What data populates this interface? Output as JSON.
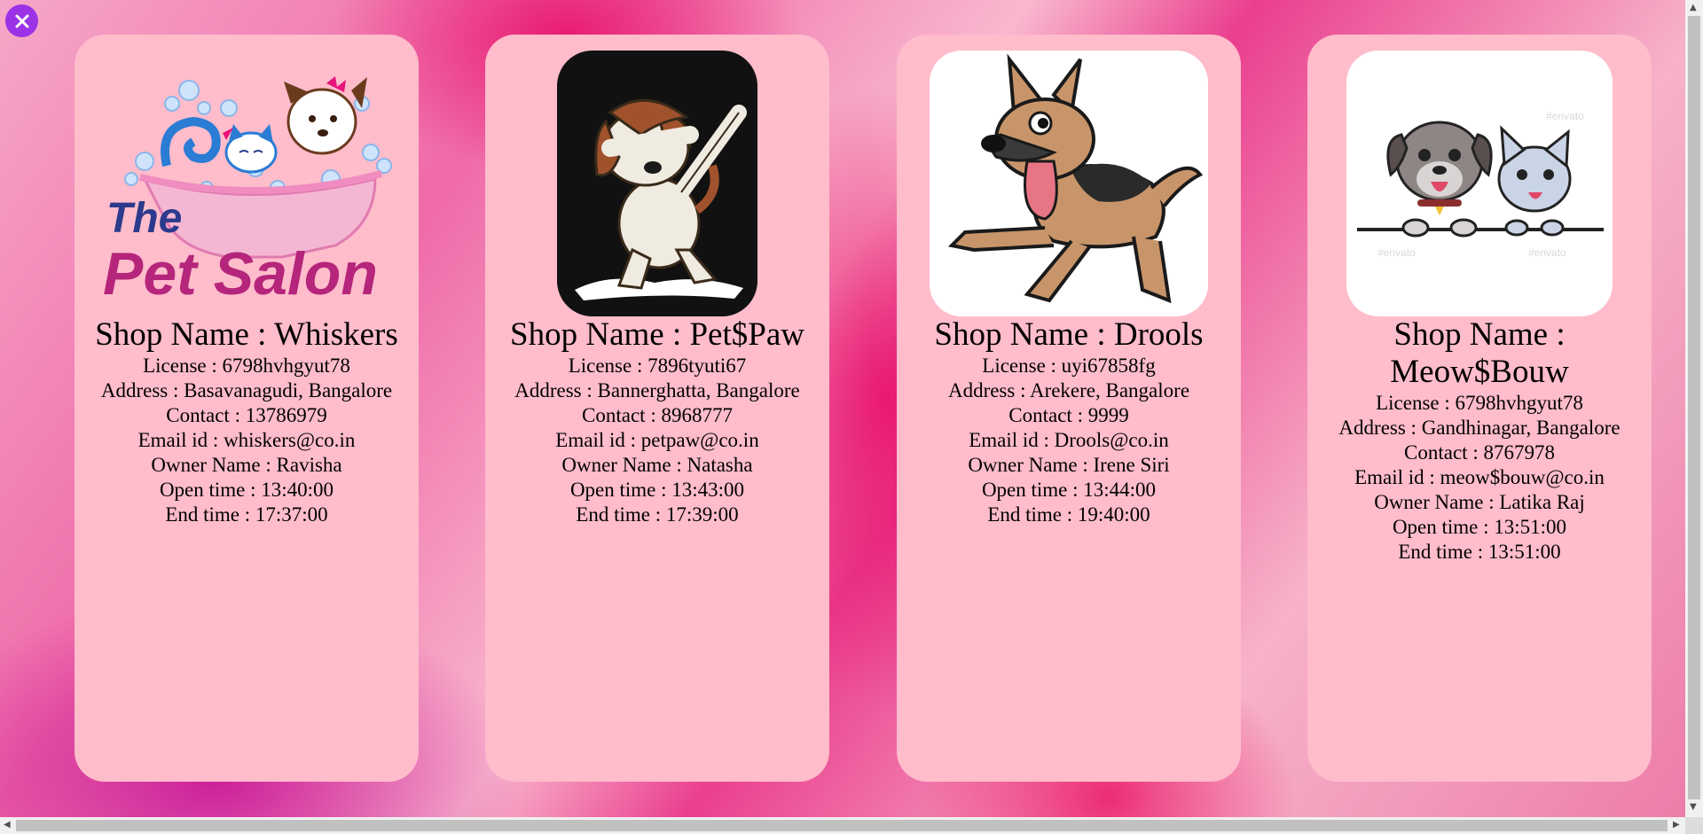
{
  "shops": [
    {
      "shop_name": "Shop Name : Whiskers",
      "license": "License : 6798hvhgyut78",
      "address": "Address : Basavanagudi, Bangalore",
      "contact": "Contact : 13786979",
      "email": "Email id : whiskers@co.in",
      "owner": "Owner Name : Ravisha",
      "open_time": "Open time : 13:40:00",
      "end_time": "End time : 17:37:00",
      "logo_text_line1": "The",
      "logo_text_line2": "Pet Salon"
    },
    {
      "shop_name": "Shop Name : Pet$Paw",
      "license": "License : 7896tyuti67",
      "address": "Address : Bannerghatta, Bangalore",
      "contact": "Contact : 8968777",
      "email": "Email id : petpaw@co.in",
      "owner": "Owner Name : Natasha",
      "open_time": "Open time : 13:43:00",
      "end_time": "End time : 17:39:00"
    },
    {
      "shop_name": "Shop Name : Drools",
      "license": "License : uyi67858fg",
      "address": "Address : Arekere, Bangalore",
      "contact": "Contact : 9999",
      "email": "Email id : Drools@co.in",
      "owner": "Owner Name : Irene Siri",
      "open_time": "Open time : 13:44:00",
      "end_time": "End time : 19:40:00"
    },
    {
      "shop_name": "Shop Name : Meow$Bouw",
      "license": "License : 6798hvhgyut78",
      "address": "Address : Gandhinagar, Bangalore",
      "contact": "Contact : 8767978",
      "email": "Email id : meow$bouw@co.in",
      "owner": "Owner Name : Latika Raj",
      "open_time": "Open time : 13:51:00",
      "end_time": "End time : 13:51:00",
      "watermark": "#envato"
    }
  ],
  "icons": {
    "close": "close-icon"
  },
  "colors": {
    "card_bg": "#ffbccb",
    "close_button": "#9b32e6",
    "accent_pink": "#e8146e"
  }
}
